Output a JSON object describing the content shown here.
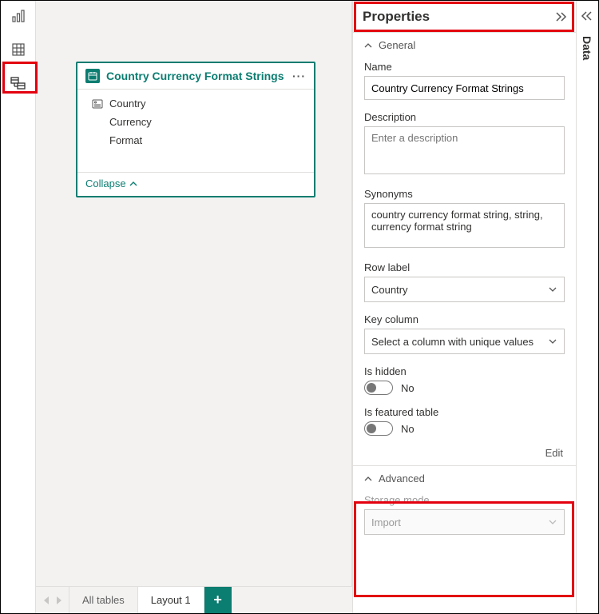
{
  "leftRail": {
    "active": "model"
  },
  "tableCard": {
    "title": "Country Currency Format Strings",
    "fields": [
      "Country",
      "Currency",
      "Format"
    ],
    "collapseLabel": "Collapse"
  },
  "footer": {
    "allTables": "All tables",
    "layout": "Layout 1"
  },
  "properties": {
    "title": "Properties",
    "sections": {
      "general": "General",
      "advanced": "Advanced"
    },
    "name": {
      "label": "Name",
      "value": "Country Currency Format Strings"
    },
    "description": {
      "label": "Description",
      "placeholder": "Enter a description"
    },
    "synonyms": {
      "label": "Synonyms",
      "value": "country currency format string, string, currency format string"
    },
    "rowLabel": {
      "label": "Row label",
      "value": "Country"
    },
    "keyColumn": {
      "label": "Key column",
      "value": "Select a column with unique values"
    },
    "isHidden": {
      "label": "Is hidden",
      "value": "No"
    },
    "isFeatured": {
      "label": "Is featured table",
      "value": "No"
    },
    "editLink": "Edit",
    "storageMode": {
      "label": "Storage mode",
      "value": "Import"
    }
  },
  "dataPane": {
    "label": "Data"
  }
}
